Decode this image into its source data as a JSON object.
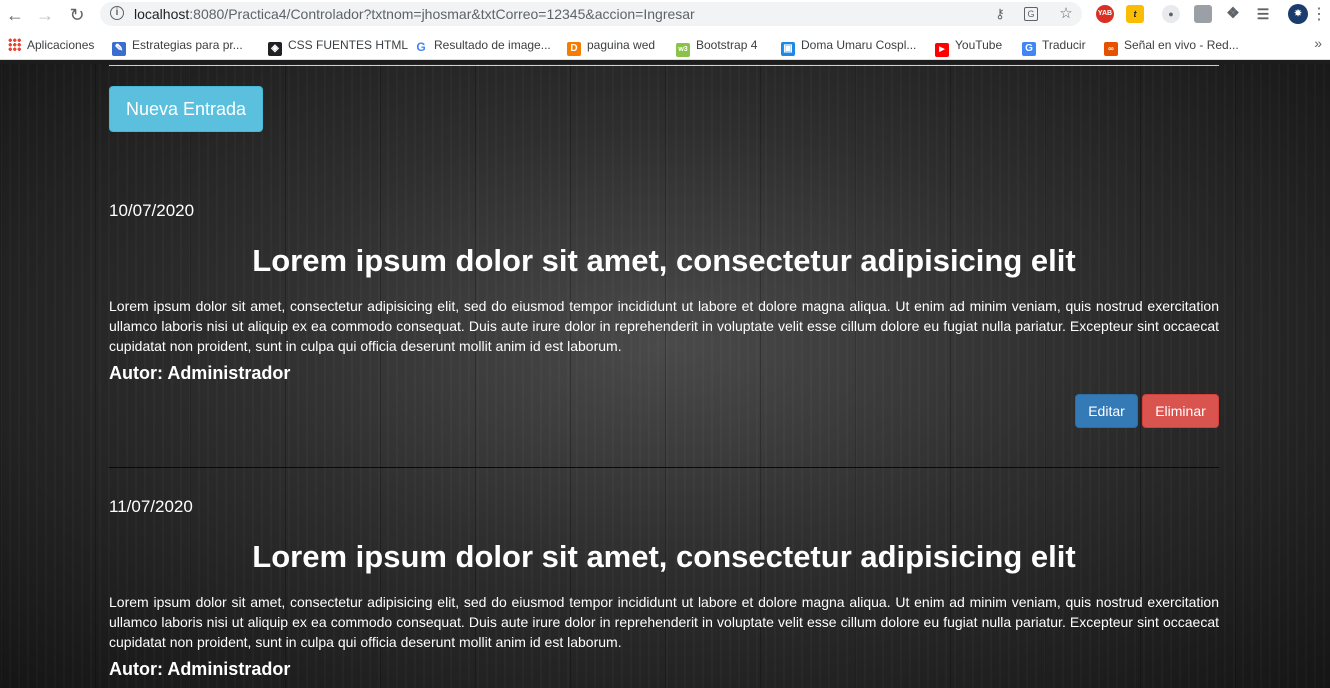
{
  "browser": {
    "url_host": "localhost",
    "url_path": ":8080/Practica4/Controlador?txtnom=jhosmar&txtCorreo=12345&accion=Ingresar",
    "extensions": [
      "YAB",
      "t"
    ],
    "bookmarks": [
      {
        "label": "Aplicaciones",
        "icon": "apps-grid-icon"
      },
      {
        "label": "Estrategias para pr...",
        "icon": "page-icon"
      },
      {
        "label": "CSS FUENTES HTML",
        "icon": "codepen-icon"
      },
      {
        "label": "Resultado de image...",
        "icon": "google-icon"
      },
      {
        "label": "paguina wed",
        "icon": "d-icon"
      },
      {
        "label": "Bootstrap 4",
        "icon": "w3-icon"
      },
      {
        "label": "Doma Umaru Cospl...",
        "icon": "bag-icon"
      },
      {
        "label": "YouTube",
        "icon": "youtube-icon"
      },
      {
        "label": "Traducir",
        "icon": "translate-icon"
      },
      {
        "label": "Señal en vivo - Red...",
        "icon": "live-icon"
      }
    ]
  },
  "page": {
    "new_entry_label": "Nueva Entrada",
    "posts": [
      {
        "date": "10/07/2020",
        "title": "Lorem ipsum dolor sit amet, consectetur adipisicing elit",
        "body": "Lorem ipsum dolor sit amet, consectetur adipisicing elit, sed do eiusmod tempor incididunt ut labore et dolore magna aliqua. Ut enim ad minim veniam, quis nostrud exercitation ullamco laboris nisi ut aliquip ex ea commodo consequat. Duis aute irure dolor in reprehenderit in voluptate velit esse cillum dolore eu fugiat nulla pariatur. Excepteur sint occaecat cupidatat non proident, sunt in culpa qui officia deserunt mollit anim id est laborum.",
        "author": "Autor: Administrador",
        "edit_label": "Editar",
        "delete_label": "Eliminar"
      },
      {
        "date": "11/07/2020",
        "title": "Lorem ipsum dolor sit amet, consectetur adipisicing elit",
        "body": "Lorem ipsum dolor sit amet, consectetur adipisicing elit, sed do eiusmod tempor incididunt ut labore et dolore magna aliqua. Ut enim ad minim veniam, quis nostrud exercitation ullamco laboris nisi ut aliquip ex ea commodo consequat. Duis aute irure dolor in reprehenderit in voluptate velit esse cillum dolore eu fugiat nulla pariatur. Excepteur sint occaecat cupidatat non proident, sunt in culpa qui officia deserunt mollit anim id est laborum.",
        "author": "Autor: Administrador"
      }
    ]
  },
  "colors": {
    "info_button": "#5bc0de",
    "primary_button": "#337ab7",
    "danger_button": "#d9534f",
    "page_background": "#2e2e2e"
  }
}
